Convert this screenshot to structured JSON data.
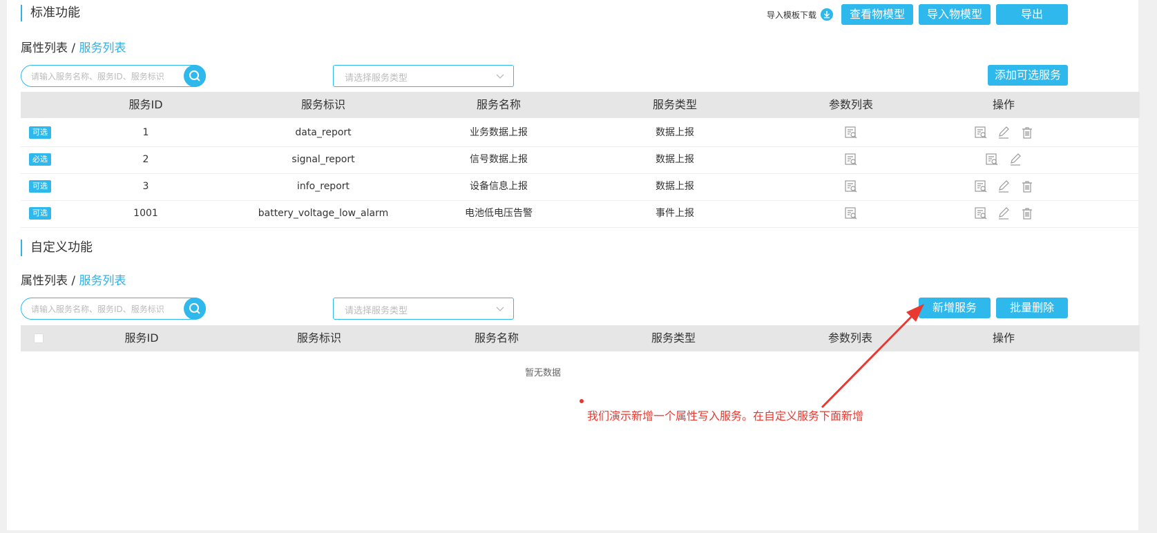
{
  "standard": {
    "title": "标准功能",
    "template_download": "导入模板下载",
    "buttons": {
      "view_model": "查看物模型",
      "import_model": "导入物模型",
      "export": "导出",
      "add_optional": "添加可选服务"
    },
    "tabs": {
      "properties": "属性列表",
      "separator": " / ",
      "services": "服务列表"
    },
    "search": {
      "placeholder": "请输入服务名称、服务ID、服务标识"
    },
    "type_select": {
      "placeholder": "请选择服务类型"
    },
    "columns": [
      "服务ID",
      "服务标识",
      "服务名称",
      "服务类型",
      "参数列表",
      "操作"
    ],
    "rows": [
      {
        "badge": "可选",
        "id": "1",
        "identifier": "data_report",
        "name": "业务数据上报",
        "type": "数据上报",
        "deletable": true
      },
      {
        "badge": "必选",
        "id": "2",
        "identifier": "signal_report",
        "name": "信号数据上报",
        "type": "数据上报",
        "deletable": false
      },
      {
        "badge": "可选",
        "id": "3",
        "identifier": "info_report",
        "name": "设备信息上报",
        "type": "数据上报",
        "deletable": true
      },
      {
        "badge": "可选",
        "id": "1001",
        "identifier": "battery_voltage_low_alarm",
        "name": "电池低电压告警",
        "type": "事件上报",
        "deletable": true
      }
    ]
  },
  "custom": {
    "title": "自定义功能",
    "tabs": {
      "properties": "属性列表",
      "separator": " / ",
      "services": "服务列表"
    },
    "search": {
      "placeholder": "请输入服务名称、服务ID、服务标识"
    },
    "type_select": {
      "placeholder": "请选择服务类型"
    },
    "buttons": {
      "add_service": "新增服务",
      "batch_delete": "批量删除"
    },
    "columns": [
      "服务ID",
      "服务标识",
      "服务名称",
      "服务类型",
      "参数列表",
      "操作"
    ],
    "empty_text": "暂无数据"
  },
  "annotation": {
    "text": "我们演示新增一个属性写入服务。在自定义服务下面新增",
    "color": "#e8382f"
  },
  "colors": {
    "accent": "#2fb8ec",
    "header_bg": "#e6e6e6"
  },
  "icons": {
    "search": "search-icon",
    "detail": "detail-icon",
    "edit": "edit-icon",
    "delete": "trash-icon",
    "download": "download-icon",
    "chevron": "chevron-down-icon"
  }
}
